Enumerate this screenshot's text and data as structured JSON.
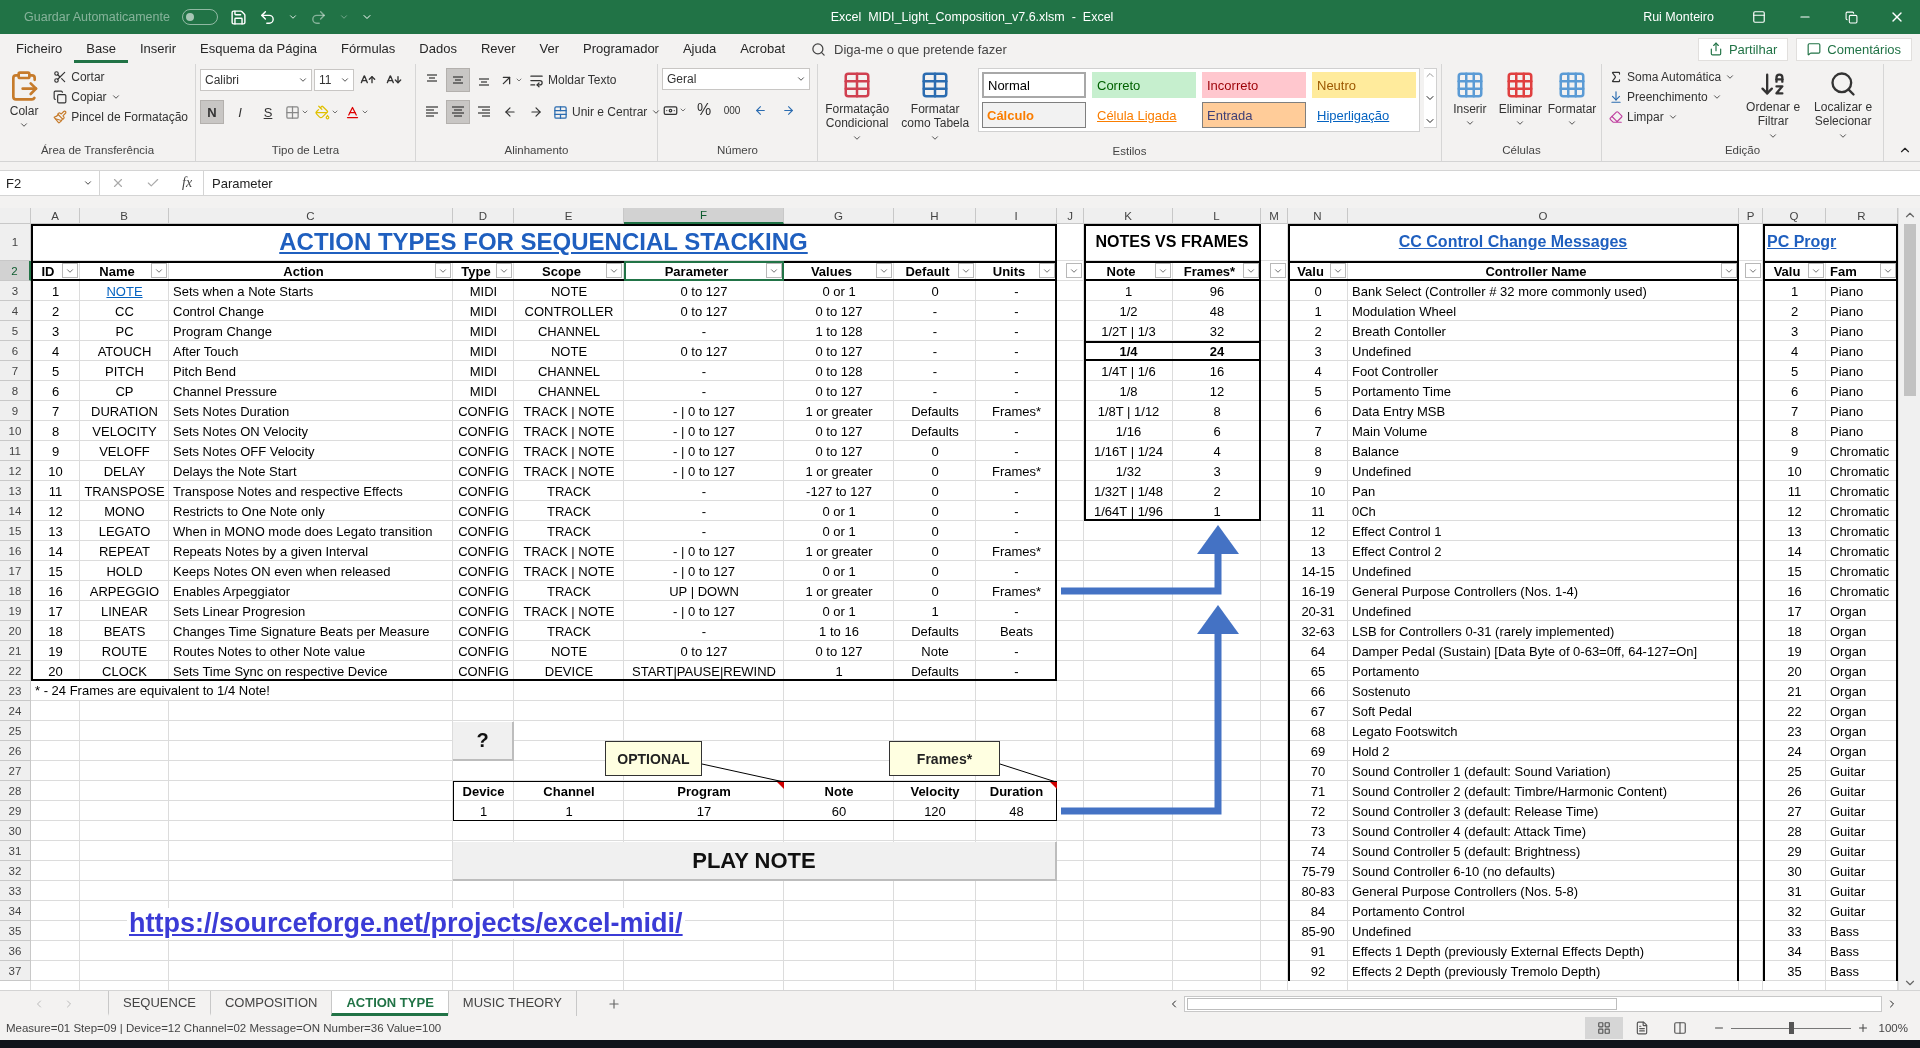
{
  "title_bar": {
    "autosave": {
      "label": "Guardar Automaticamente",
      "on": false
    },
    "title": "Excel  MIDI_Light_Composition_v7.6.xlsm  -  Excel",
    "user": "Rui Monteiro"
  },
  "menu": {
    "tabs": [
      {
        "label": "Ficheiro",
        "selected": false
      },
      {
        "label": "Base",
        "selected": true
      },
      {
        "label": "Inserir",
        "selected": false
      },
      {
        "label": "Esquema da Página",
        "selected": false
      },
      {
        "label": "Fórmulas",
        "selected": false
      },
      {
        "label": "Dados",
        "selected": false
      },
      {
        "label": "Rever",
        "selected": false
      },
      {
        "label": "Ver",
        "selected": false
      },
      {
        "label": "Programador",
        "selected": false
      },
      {
        "label": "Ajuda",
        "selected": false
      },
      {
        "label": "Acrobat",
        "selected": false
      }
    ],
    "tell_me": {
      "placeholder": "Diga-me o que pretende fazer"
    },
    "share": "Partilhar",
    "comments": "Comentários"
  },
  "ribbon": {
    "clipboard": {
      "label": "Área de Transferência",
      "paste": "Colar",
      "cut": "Cortar",
      "copy": "Copiar",
      "format_painter": "Pincel de Formatação"
    },
    "font": {
      "label": "Tipo de Letra",
      "name": "Calibri",
      "size": "11",
      "toggles": [
        {
          "label": "N",
          "kind": "bold",
          "on": true
        },
        {
          "label": "I",
          "kind": "italic",
          "on": false
        },
        {
          "label": "S",
          "kind": "underline",
          "on": false
        }
      ]
    },
    "alignment": {
      "label": "Alinhamento",
      "vertical": [
        {
          "kind": "top",
          "on": false
        },
        {
          "kind": "middle",
          "on": true
        },
        {
          "kind": "bottom",
          "on": false
        }
      ],
      "horizontal": [
        {
          "kind": "left",
          "on": false
        },
        {
          "kind": "center",
          "on": true
        },
        {
          "kind": "right",
          "on": false
        }
      ],
      "wrap_text": "Moldar Texto",
      "merge_center": "Unir e Centrar"
    },
    "number": {
      "label": "Número",
      "format": "Geral",
      "percent": "%",
      "thousands": "000"
    },
    "styles": {
      "label": "Estilos",
      "conditional": "Formatação Condicional",
      "as_table": "Formatar como Tabela",
      "gallery": [
        {
          "label": "Normal",
          "kind": "normal"
        },
        {
          "label": "Correto",
          "kind": "good"
        },
        {
          "label": "Incorreto",
          "kind": "bad"
        },
        {
          "label": "Neutro",
          "kind": "neutral"
        },
        {
          "label": "Cálculo",
          "kind": "calc"
        },
        {
          "label": "Célula Ligada",
          "kind": "linked"
        },
        {
          "label": "Entrada",
          "kind": "input"
        },
        {
          "label": "Hiperligação",
          "kind": "hyperlink"
        }
      ]
    },
    "cells": {
      "label": "Células",
      "buttons": [
        {
          "label": "Inserir",
          "kind": "insert"
        },
        {
          "label": "Eliminar",
          "kind": "delete"
        },
        {
          "label": "Formatar",
          "kind": "format"
        }
      ]
    },
    "editing": {
      "label": "Edição",
      "autosum": "Soma Automática",
      "fill": "Preenchimento",
      "clear": "Limpar",
      "sort": "Ordenar e Filtrar",
      "find": "Localizar e Selecionar"
    }
  },
  "formula_bar": {
    "name_box": "F2",
    "fx": "fx",
    "value": "Parameter"
  },
  "columns": [
    {
      "letter": "A",
      "selected": false
    },
    {
      "letter": "B",
      "selected": false
    },
    {
      "letter": "C",
      "selected": false
    },
    {
      "letter": "D",
      "selected": false
    },
    {
      "letter": "E",
      "selected": false
    },
    {
      "letter": "F",
      "selected": true
    },
    {
      "letter": "G",
      "selected": false
    },
    {
      "letter": "H",
      "selected": false
    },
    {
      "letter": "I",
      "selected": false
    },
    {
      "letter": "J",
      "selected": false
    },
    {
      "letter": "K",
      "selected": false
    },
    {
      "letter": "L",
      "selected": false
    },
    {
      "letter": "M",
      "selected": false
    },
    {
      "letter": "N",
      "selected": false
    },
    {
      "letter": "O",
      "selected": false
    },
    {
      "letter": "P",
      "selected": false
    },
    {
      "letter": "Q",
      "selected": false
    },
    {
      "letter": "R",
      "selected": false
    }
  ],
  "rows": [
    {
      "number": "1",
      "selected": false
    },
    {
      "number": "2",
      "selected": true
    },
    {
      "number": "3",
      "selected": false
    },
    {
      "number": "4",
      "selected": false
    },
    {
      "number": "5",
      "selected": false
    },
    {
      "number": "6",
      "selected": false
    },
    {
      "number": "7",
      "selected": false
    },
    {
      "number": "8",
      "selected": false
    },
    {
      "number": "9",
      "selected": false
    },
    {
      "number": "10",
      "selected": false
    },
    {
      "number": "11",
      "selected": false
    },
    {
      "number": "12",
      "selected": false
    },
    {
      "number": "13",
      "selected": false
    },
    {
      "number": "14",
      "selected": false
    },
    {
      "number": "15",
      "selected": false
    },
    {
      "number": "16",
      "selected": false
    },
    {
      "number": "17",
      "selected": false
    },
    {
      "number": "18",
      "selected": false
    },
    {
      "number": "19",
      "selected": false
    },
    {
      "number": "20",
      "selected": false
    },
    {
      "number": "21",
      "selected": false
    },
    {
      "number": "22",
      "selected": false
    },
    {
      "number": "23",
      "selected": false
    },
    {
      "number": "24",
      "selected": false
    },
    {
      "number": "25",
      "selected": false
    },
    {
      "number": "26",
      "selected": false
    },
    {
      "number": "27",
      "selected": false
    },
    {
      "number": "28",
      "selected": false
    },
    {
      "number": "29",
      "selected": false
    },
    {
      "number": "30",
      "selected": false
    },
    {
      "number": "31",
      "selected": false
    },
    {
      "number": "32",
      "selected": false
    },
    {
      "number": "33",
      "selected": false
    },
    {
      "number": "34",
      "selected": false
    },
    {
      "number": "35",
      "selected": false
    },
    {
      "number": "36",
      "selected": false
    },
    {
      "number": "37",
      "selected": false
    }
  ],
  "action_table": {
    "title": "ACTION TYPES FOR SEQUENCIAL STACKING",
    "headers": [
      "ID",
      "Name",
      "Action",
      "Type",
      "Scope",
      "Parameter",
      "Values",
      "Default",
      "Units"
    ],
    "rows": [
      {
        "id": "1",
        "name": "NOTE",
        "name_is_link": true,
        "action": "Sets when a Note Starts",
        "type": "MIDI",
        "scope": "NOTE",
        "parameter": "0 to 127",
        "values": "0 or 1",
        "default": "0",
        "units": "-"
      },
      {
        "id": "2",
        "name": "CC",
        "name_is_link": false,
        "action": "Control Change",
        "type": "MIDI",
        "scope": "CONTROLLER",
        "parameter": "0 to 127",
        "values": "0 to 127",
        "default": "-",
        "units": "-"
      },
      {
        "id": "3",
        "name": "PC",
        "name_is_link": false,
        "action": "Program Change",
        "type": "MIDI",
        "scope": "CHANNEL",
        "parameter": "-",
        "values": "1 to 128",
        "default": "-",
        "units": "-"
      },
      {
        "id": "4",
        "name": "ATOUCH",
        "name_is_link": false,
        "action": "After Touch",
        "type": "MIDI",
        "scope": "NOTE",
        "parameter": "0 to 127",
        "values": "0 to 127",
        "default": "-",
        "units": "-"
      },
      {
        "id": "5",
        "name": "PITCH",
        "name_is_link": false,
        "action": "Pitch Bend",
        "type": "MIDI",
        "scope": "CHANNEL",
        "parameter": "-",
        "values": "0 to 128",
        "default": "-",
        "units": "-"
      },
      {
        "id": "6",
        "name": "CP",
        "name_is_link": false,
        "action": "Channel Pressure",
        "type": "MIDI",
        "scope": "CHANNEL",
        "parameter": "-",
        "values": "0 to 127",
        "default": "-",
        "units": "-"
      },
      {
        "id": "7",
        "name": "DURATION",
        "name_is_link": false,
        "action": "Sets Notes Duration",
        "type": "CONFIG",
        "scope": "TRACK | NOTE",
        "parameter": "- | 0 to 127",
        "values": "1 or greater",
        "default": "Defaults",
        "units": "Frames*"
      },
      {
        "id": "8",
        "name": "VELOCITY",
        "name_is_link": false,
        "action": "Sets Notes ON Velocity",
        "type": "CONFIG",
        "scope": "TRACK | NOTE",
        "parameter": "- | 0 to 127",
        "values": "0 to 127",
        "default": "Defaults",
        "units": "-"
      },
      {
        "id": "9",
        "name": "VELOFF",
        "name_is_link": false,
        "action": "Sets Notes OFF Velocity",
        "type": "CONFIG",
        "scope": "TRACK | NOTE",
        "parameter": "- | 0 to 127",
        "values": "0 to 127",
        "default": "0",
        "units": "-"
      },
      {
        "id": "10",
        "name": "DELAY",
        "name_is_link": false,
        "action": "Delays the Note Start",
        "type": "CONFIG",
        "scope": "TRACK | NOTE",
        "parameter": "- | 0 to 127",
        "values": "1 or greater",
        "default": "0",
        "units": "Frames*"
      },
      {
        "id": "11",
        "name": "TRANSPOSE",
        "name_is_link": false,
        "action": "Transpose Notes and respective Effects",
        "type": "CONFIG",
        "scope": "TRACK",
        "parameter": "-",
        "values": "-127 to 127",
        "default": "0",
        "units": "-"
      },
      {
        "id": "12",
        "name": "MONO",
        "name_is_link": false,
        "action": "Restricts to One Note only",
        "type": "CONFIG",
        "scope": "TRACK",
        "parameter": "-",
        "values": "0 or 1",
        "default": "0",
        "units": "-"
      },
      {
        "id": "13",
        "name": "LEGATO",
        "name_is_link": false,
        "action": "When in MONO mode does Legato transition",
        "type": "CONFIG",
        "scope": "TRACK",
        "parameter": "-",
        "values": "0 or 1",
        "default": "0",
        "units": "-"
      },
      {
        "id": "14",
        "name": "REPEAT",
        "name_is_link": false,
        "action": "Repeats Notes by a given Interval",
        "type": "CONFIG",
        "scope": "TRACK | NOTE",
        "parameter": "- | 0 to 127",
        "values": "1 or greater",
        "default": "0",
        "units": "Frames*"
      },
      {
        "id": "15",
        "name": "HOLD",
        "name_is_link": false,
        "action": "Keeps Notes ON even when released",
        "type": "CONFIG",
        "scope": "TRACK | NOTE",
        "parameter": "- | 0 to 127",
        "values": "0 or 1",
        "default": "0",
        "units": "-"
      },
      {
        "id": "16",
        "name": "ARPEGGIO",
        "name_is_link": false,
        "action": "Enables Arpeggiator",
        "type": "CONFIG",
        "scope": "TRACK",
        "parameter": "UP | DOWN",
        "values": "1 or greater",
        "default": "0",
        "units": "Frames*"
      },
      {
        "id": "17",
        "name": "LINEAR",
        "name_is_link": false,
        "action": "Sets Linear Progresion",
        "type": "CONFIG",
        "scope": "TRACK | NOTE",
        "parameter": "- | 0 to 127",
        "values": "0 or 1",
        "default": "1",
        "units": "-"
      },
      {
        "id": "18",
        "name": "BEATS",
        "name_is_link": false,
        "action": "Changes Time Signature Beats per Measure",
        "type": "CONFIG",
        "scope": "TRACK",
        "parameter": "-",
        "values": "1 to 16",
        "default": "Defaults",
        "units": "Beats"
      },
      {
        "id": "19",
        "name": "ROUTE",
        "name_is_link": false,
        "action": "Routes Notes to other Note value",
        "type": "CONFIG",
        "scope": "NOTE",
        "parameter": "0 to 127",
        "values": "0 to 127",
        "default": "Note",
        "units": "-"
      },
      {
        "id": "20",
        "name": "CLOCK",
        "name_is_link": false,
        "action": "Sets Time Sync on respective Device",
        "type": "CONFIG",
        "scope": "DEVICE",
        "parameter": "START|PAUSE|REWIND",
        "values": "1",
        "default": "Defaults",
        "units": "-"
      }
    ],
    "footnote": "* - 24 Frames are equivalent to 1/4 Note!"
  },
  "notes_table": {
    "title": "NOTES VS FRAMES",
    "headers": [
      "Note",
      "Frames*"
    ],
    "rows": [
      {
        "note": "1",
        "frames": "96",
        "emphasized": false
      },
      {
        "note": "1/2",
        "frames": "48",
        "emphasized": false
      },
      {
        "note": "1/2T | 1/3",
        "frames": "32",
        "emphasized": false
      },
      {
        "note": "1/4",
        "frames": "24",
        "emphasized": true
      },
      {
        "note": "1/4T | 1/6",
        "frames": "16",
        "emphasized": false
      },
      {
        "note": "1/8",
        "frames": "12",
        "emphasized": false
      },
      {
        "note": "1/8T | 1/12",
        "frames": "8",
        "emphasized": false
      },
      {
        "note": "1/16",
        "frames": "6",
        "emphasized": false
      },
      {
        "note": "1/16T | 1/24",
        "frames": "4",
        "emphasized": false
      },
      {
        "note": "1/32",
        "frames": "3",
        "emphasized": false
      },
      {
        "note": "1/32T | 1/48",
        "frames": "2",
        "emphasized": false
      },
      {
        "note": "1/64T | 1/96",
        "frames": "1",
        "emphasized": false
      }
    ]
  },
  "cc_table": {
    "title": "CC Control Change Messages",
    "headers": [
      "Valu",
      "Controller Name"
    ],
    "rows": [
      {
        "value": "0",
        "name": "Bank Select (Controller # 32 more commonly used)"
      },
      {
        "value": "1",
        "name": "Modulation Wheel"
      },
      {
        "value": "2",
        "name": "Breath Contoller"
      },
      {
        "value": "3",
        "name": "Undefined"
      },
      {
        "value": "4",
        "name": "Foot Controller"
      },
      {
        "value": "5",
        "name": "Portamento Time"
      },
      {
        "value": "6",
        "name": "Data Entry MSB"
      },
      {
        "value": "7",
        "name": "Main Volume"
      },
      {
        "value": "8",
        "name": "Balance"
      },
      {
        "value": "9",
        "name": "Undefined"
      },
      {
        "value": "10",
        "name": "Pan"
      },
      {
        "value": "11",
        "name": "0Ch"
      },
      {
        "value": "12",
        "name": "Effect Control 1"
      },
      {
        "value": "13",
        "name": "Effect Control 2"
      },
      {
        "value": "14-15",
        "name": "Undefined"
      },
      {
        "value": "16-19",
        "name": "General Purpose Controllers (Nos. 1-4)"
      },
      {
        "value": "20-31",
        "name": "Undefined"
      },
      {
        "value": "32-63",
        "name": "LSB for Controllers 0-31 (rarely implemented)"
      },
      {
        "value": "64",
        "name": "Damper Pedal (Sustain) [Data Byte of 0-63=0ff, 64-127=On]"
      },
      {
        "value": "65",
        "name": "Portamento"
      },
      {
        "value": "66",
        "name": "Sostenuto"
      },
      {
        "value": "67",
        "name": "Soft Pedal"
      },
      {
        "value": "68",
        "name": "Legato Footswitch"
      },
      {
        "value": "69",
        "name": "Hold 2"
      },
      {
        "value": "70",
        "name": "Sound Controller 1 (default: Sound Variation)"
      },
      {
        "value": "71",
        "name": "Sound Controller 2 (default: Timbre/Harmonic Content)"
      },
      {
        "value": "72",
        "name": "Sound Controller 3 (default: Release Time)"
      },
      {
        "value": "73",
        "name": "Sound Controller 4 (default: Attack Time)"
      },
      {
        "value": "74",
        "name": "Sound Controller 5 (default: Brightness)"
      },
      {
        "value": "75-79",
        "name": "Sound Controller 6-10 (no defaults)"
      },
      {
        "value": "80-83",
        "name": "General Purpose Controllers (Nos. 5-8)"
      },
      {
        "value": "84",
        "name": "Portamento Control"
      },
      {
        "value": "85-90",
        "name": "Undefined"
      },
      {
        "value": "91",
        "name": "Effects 1 Depth (previously External Effects Depth)"
      },
      {
        "value": "92",
        "name": "Effects 2 Depth (previously Tremolo Depth)"
      }
    ]
  },
  "pc_table": {
    "title": "PC Progr",
    "headers": [
      "Valu",
      "Fam"
    ],
    "rows": [
      {
        "value": "1",
        "family": "Piano"
      },
      {
        "value": "2",
        "family": "Piano"
      },
      {
        "value": "3",
        "family": "Piano"
      },
      {
        "value": "4",
        "family": "Piano"
      },
      {
        "value": "5",
        "family": "Piano"
      },
      {
        "value": "6",
        "family": "Piano"
      },
      {
        "value": "7",
        "family": "Piano"
      },
      {
        "value": "8",
        "family": "Piano"
      },
      {
        "value": "9",
        "family": "Chromatic"
      },
      {
        "value": "10",
        "family": "Chromatic"
      },
      {
        "value": "11",
        "family": "Chromatic"
      },
      {
        "value": "12",
        "family": "Chromatic"
      },
      {
        "value": "13",
        "family": "Chromatic"
      },
      {
        "value": "14",
        "family": "Chromatic"
      },
      {
        "value": "15",
        "family": "Chromatic"
      },
      {
        "value": "16",
        "family": "Chromatic"
      },
      {
        "value": "17",
        "family": "Organ"
      },
      {
        "value": "18",
        "family": "Organ"
      },
      {
        "value": "19",
        "family": "Organ"
      },
      {
        "value": "20",
        "family": "Organ"
      },
      {
        "value": "21",
        "family": "Organ"
      },
      {
        "value": "22",
        "family": "Organ"
      },
      {
        "value": "23",
        "family": "Organ"
      },
      {
        "value": "24",
        "family": "Organ"
      },
      {
        "value": "25",
        "family": "Guitar"
      },
      {
        "value": "26",
        "family": "Guitar"
      },
      {
        "value": "27",
        "family": "Guitar"
      },
      {
        "value": "28",
        "family": "Guitar"
      },
      {
        "value": "29",
        "family": "Guitar"
      },
      {
        "value": "30",
        "family": "Guitar"
      },
      {
        "value": "31",
        "family": "Guitar"
      },
      {
        "value": "32",
        "family": "Guitar"
      },
      {
        "value": "33",
        "family": "Bass"
      },
      {
        "value": "34",
        "family": "Bass"
      },
      {
        "value": "35",
        "family": "Bass"
      }
    ]
  },
  "controls": {
    "help_button": "?",
    "callouts": [
      "OPTIONAL",
      "Frames*"
    ],
    "form": {
      "headers": [
        "Device",
        "Channel",
        "Program",
        "Note",
        "Velocity",
        "Duration"
      ],
      "values": [
        "1",
        "1",
        "17",
        "60",
        "120",
        "48"
      ]
    },
    "play_button": "PLAY NOTE",
    "link": "https://sourceforge.net/projects/excel-midi/"
  },
  "sheet_tabs": [
    {
      "label": "SEQUENCE",
      "selected": false
    },
    {
      "label": "COMPOSITION",
      "selected": false
    },
    {
      "label": "ACTION TYPE",
      "selected": true
    },
    {
      "label": "MUSIC THEORY",
      "selected": false
    }
  ],
  "status_bar": {
    "text": "Measure=01 Step=09 | Device=12 Channel=02 Message=ON  Number=36 Value=100",
    "views": [
      {
        "kind": "normal",
        "selected": true
      },
      {
        "kind": "page_layout",
        "selected": false
      },
      {
        "kind": "page_break",
        "selected": false
      }
    ],
    "zoom": {
      "level": 0.5,
      "reading": "100%"
    }
  }
}
